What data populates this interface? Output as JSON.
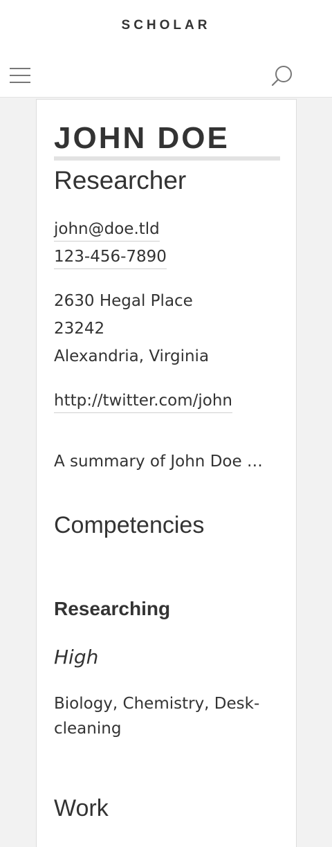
{
  "header": {
    "brand": "SCHOLAR",
    "menu_icon": "hamburger-menu-icon",
    "search_icon": "search-icon"
  },
  "profile": {
    "name": "JOHN DOE",
    "label": "Researcher",
    "email": "john@doe.tld",
    "phone": "123-456-7890",
    "address": "2630 Hegal Place",
    "postal_code": "23242",
    "city_region": "Alexandria, Virginia",
    "website": "http://twitter.com/john",
    "summary": "A summary of John Doe …"
  },
  "competencies": {
    "heading": "Competencies",
    "items": [
      {
        "name": "Researching",
        "level": "High",
        "keywords": "Biology, Chemistry, Desk-cleaning"
      }
    ]
  },
  "work": {
    "heading": "Work"
  },
  "colors": {
    "text": "#333333",
    "background": "#f2f2f2",
    "card": "#ffffff",
    "rule": "#e2e2e2"
  }
}
